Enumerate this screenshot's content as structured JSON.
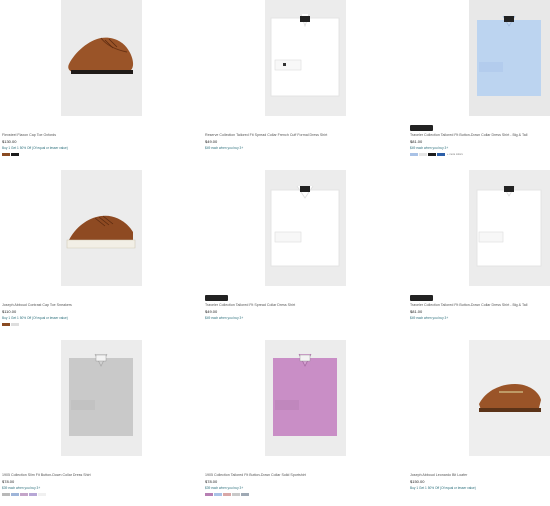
{
  "products": [
    {
      "title": "Flexsteel Flaxon Cap Toe Oxfords",
      "price": "$130.00",
      "promo": "Buy 1 Get 1 50% Off (Of equal or lesser value)",
      "swatches": [
        "#8a4b22",
        "#1c1c1c"
      ],
      "more_label": "",
      "badge": false,
      "image": "shoe-oxford-icon"
    },
    {
      "title": "Reserve Collection Tailored Fit Spread Collar French Cuff Formal Dress Shirt",
      "price": "$49.00",
      "promo": "$49 each when you buy 3+",
      "swatches": [],
      "more_label": "",
      "badge": false,
      "image": "white-french-cuff-shirt"
    },
    {
      "title": "Traveler Collection Tailored Fit Button-Down Collar Dress Shirt - Big & Tall",
      "price": "$81.00",
      "promo": "$49 each when you buy 3+",
      "swatches": [
        "#a9c2e6",
        "#e6e6e6",
        "#1c1c1c",
        "#2c5fa8"
      ],
      "more_label": "+ more colors",
      "badge": true,
      "image": "blue-dress-shirt"
    },
    {
      "title": "Joseph Abboud Contrast Cap Toe Sneakers",
      "price": "$110.00",
      "promo": "Buy 1 Get 1 50% Off (Of equal or lesser value)",
      "swatches": [
        "#8a4b22",
        "#dedede"
      ],
      "more_label": "",
      "badge": false,
      "image": "brown-sneaker"
    },
    {
      "title": "Traveler Collection Tailored Fit Spread Collar Dress Shirt",
      "price": "$49.00",
      "promo": "$49 each when you buy 3+",
      "swatches": [],
      "more_label": "",
      "badge": true,
      "image": "white-spread-collar-shirt"
    },
    {
      "title": "Traveler Collection Tailored Fit Button-Down Collar Dress Shirt - Big & Tall",
      "price": "$81.00",
      "promo": "$49 each when you buy 3+",
      "swatches": [],
      "more_label": "",
      "badge": true,
      "image": "white-button-down-shirt"
    },
    {
      "title": "1905 Collection Slim Fit Button-Down Collar Dress Shirt",
      "price": "$78.00",
      "promo": "$39 each when you buy 3+",
      "swatches": [
        "#b9b9b9",
        "#9fb5d9",
        "#c4a5c9",
        "#b7a7d6",
        "#f0f0f0"
      ],
      "more_label": "",
      "badge": false,
      "image": "gray-dress-shirt"
    },
    {
      "title": "1905 Collection Tailored Fit Button-Down Collar Solid Sportshirt",
      "price": "$78.00",
      "promo": "$39 each when you buy 3+",
      "swatches": [
        "#b77fb3",
        "#a9c2e6",
        "#d9a7a7",
        "#c9c9c9",
        "#9fa9b4"
      ],
      "more_label": "",
      "badge": false,
      "image": "lilac-sportshirt"
    },
    {
      "title": "Joseph Abboud Leonardo Bit Loafer",
      "price": "$150.00",
      "promo": "Buy 1 Get 1 50% Off (Of equal or lesser value)",
      "swatches": [],
      "more_label": "",
      "badge": false,
      "image": "brown-bit-loafer"
    }
  ]
}
